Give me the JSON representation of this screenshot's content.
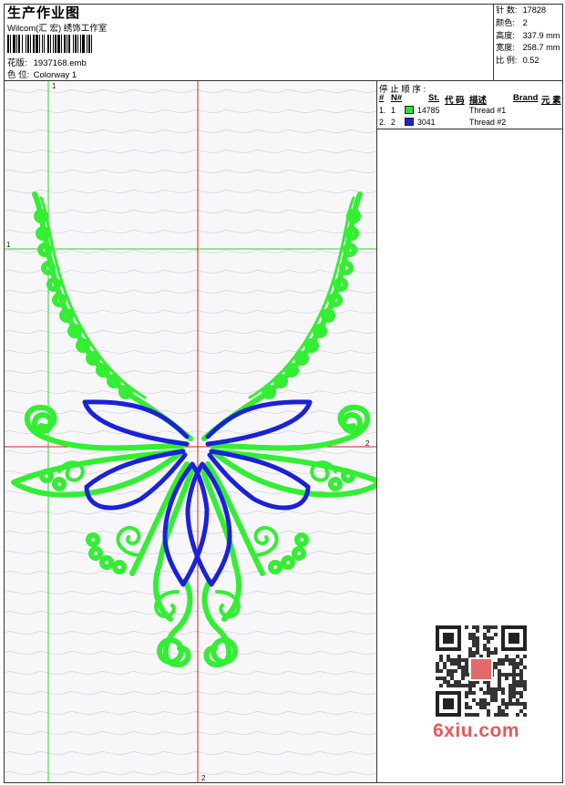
{
  "header": {
    "title": "生产作业图",
    "company": "Wilcom(汇 宏) 绣饰工作室",
    "design_label": "花版:",
    "design_file": "1937168.emb",
    "colorway_label": "色 位:",
    "colorway": "Colorway 1"
  },
  "stats": [
    {
      "label": "针 数:",
      "value": "17828"
    },
    {
      "label": "颜色:",
      "value": "2"
    },
    {
      "label": "高度:",
      "value": "337.9 mm"
    },
    {
      "label": "宽度:",
      "value": "258.7 mm"
    },
    {
      "label": "比 例:",
      "value": "0.52"
    }
  ],
  "sequence": {
    "title": "停 止 顺 序 :",
    "headers": {
      "hash": "#",
      "n": "N#",
      "st": "St.",
      "code": "代 码",
      "desc": "描述",
      "brand": "Brand",
      "element": "元 素"
    },
    "rows": [
      {
        "index": "1.",
        "n": "1",
        "color": "#33dd33",
        "stitches": "14785",
        "desc": "Thread #1"
      },
      {
        "index": "2.",
        "n": "2",
        "color": "#1a22d6",
        "stitches": "3041",
        "desc": "Thread #2"
      }
    ]
  },
  "design": {
    "marks": {
      "green_v": "1",
      "green_h": "1",
      "red_h": "2",
      "red_v": "2"
    },
    "green_color": "#33ee33",
    "blue_color": "#1a22d6",
    "axis_green": "#33cc33",
    "axis_red": "#dd2222"
  },
  "watermark": "6xiu.com"
}
